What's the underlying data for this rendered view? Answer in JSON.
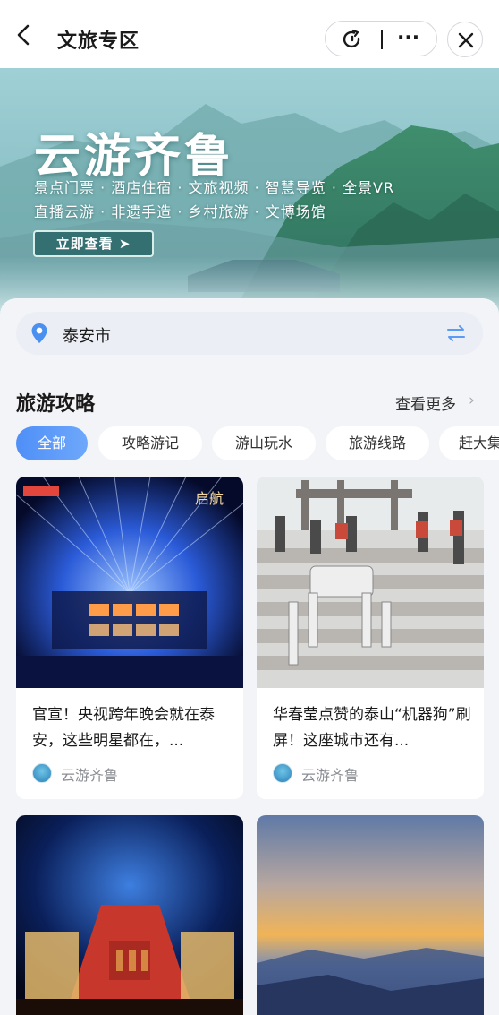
{
  "header": {
    "title": "文旅专区"
  },
  "banner": {
    "title": "云游齐鲁",
    "line1": "景点门票 · 酒店住宿 · 文旅视频 · 智慧导览 · 全景VR",
    "line2": "直播云游 · 非遗手造 · 乡村旅游 · 文博场馆",
    "button": "立即查看 ➤"
  },
  "location": {
    "city": "泰安市"
  },
  "section": {
    "title": "旅游攻略",
    "more": "查看更多",
    "more_arrow": "›",
    "chips": [
      "全部",
      "攻略游记",
      "游山玩水",
      "旅游线路",
      "赶大集"
    ]
  },
  "posts": [
    {
      "title": "官宣！央视跨年晚会就在泰安，这些明星都在，...",
      "author": "云游齐鲁",
      "image": "stage-light-show"
    },
    {
      "title": "华春莹点赞的泰山“机器狗”刷屏！这座城市还有...",
      "author": "云游齐鲁",
      "image": "robot-dog-stairs"
    },
    {
      "title": "",
      "author": "",
      "image": "night-performance"
    },
    {
      "title": "",
      "author": "",
      "image": "sunrise-mountains"
    }
  ],
  "colors": {
    "accent": "#4f8ff7",
    "banner": "#5aa0a9"
  }
}
